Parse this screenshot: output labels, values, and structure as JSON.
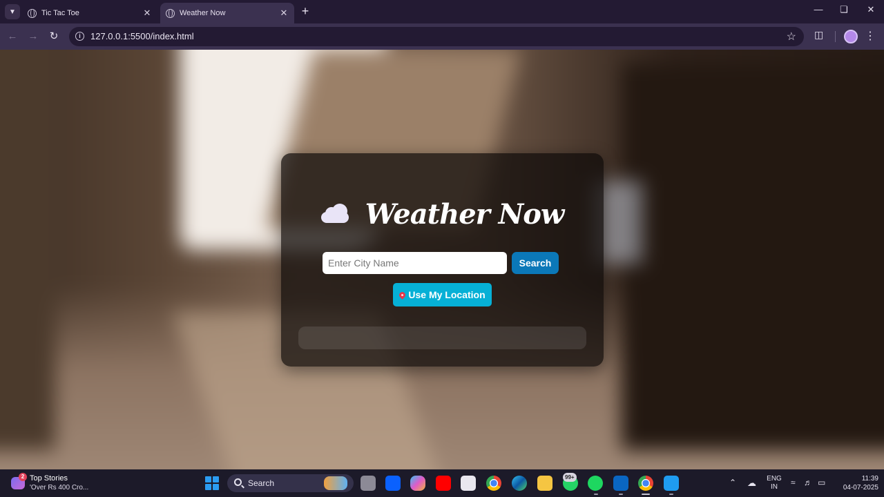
{
  "browser": {
    "tabs": [
      {
        "title": "Tic Tac Toe",
        "active": false
      },
      {
        "title": "Weather Now",
        "active": true
      }
    ],
    "url": "127.0.0.1:5500/index.html"
  },
  "app": {
    "title": "Weather Now",
    "icon": "cloud-icon",
    "search": {
      "placeholder": "Enter City Name",
      "value": "",
      "button_label": "Search"
    },
    "location_button_label": "Use My Location",
    "location_icon": "pin-icon",
    "colors": {
      "search_button": "#0b78b8",
      "location_button": "#06b0d6"
    }
  },
  "taskbar": {
    "news": {
      "badge": "2",
      "title": "Top Stories",
      "subtitle": "'Over Rs 400 Cro..."
    },
    "search_label": "Search",
    "whatsapp_badge": "99+",
    "language": {
      "line1": "ENG",
      "line2": "IN"
    },
    "time": "11:39",
    "date": "04-07-2025"
  }
}
